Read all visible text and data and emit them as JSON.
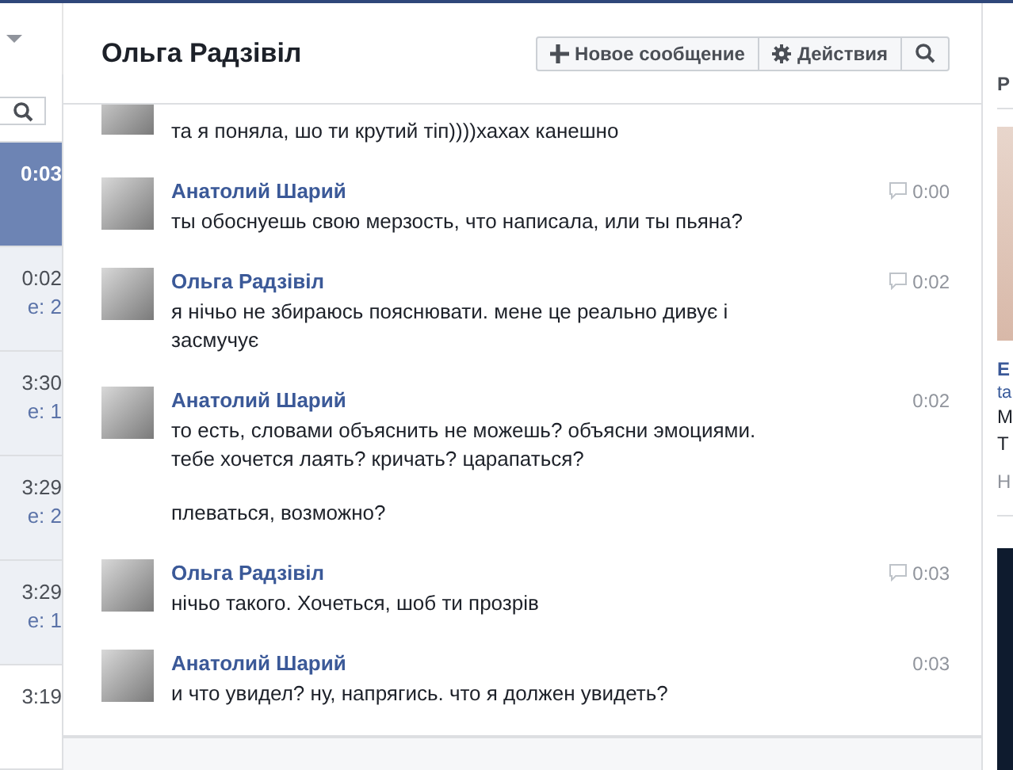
{
  "conversations": {
    "items": [
      {
        "time": "0:03",
        "selected": true,
        "unread": false
      },
      {
        "time": "0:02",
        "snippet": "e: 2",
        "selected": false,
        "unread": true
      },
      {
        "time": "3:30",
        "snippet": "e: 1",
        "selected": false,
        "unread": true
      },
      {
        "time": "3:29",
        "snippet": "e: 2",
        "selected": false,
        "unread": true
      },
      {
        "time": "3:29",
        "snippet": "e: 1",
        "selected": false,
        "unread": true
      },
      {
        "time": "3:19",
        "selected": false,
        "unread": false
      }
    ]
  },
  "thread": {
    "title": "Ольга Радзівіл",
    "buttons": [
      {
        "kind": "plus",
        "label": "Новое сообщение"
      },
      {
        "kind": "gear",
        "label": "Действия"
      },
      {
        "kind": "search"
      }
    ],
    "messages": [
      {
        "paragraphs": [
          "та я поняла, шо ти крутий тіп))))хахах канешно"
        ]
      },
      {
        "author": "Анатолий Шарий",
        "time": "0:00",
        "seen_icon": true,
        "paragraphs": [
          "ты обоснуешь свою мерзость, что написала, или ты пьяна?"
        ]
      },
      {
        "author": "Ольга Радзівіл",
        "time": "0:02",
        "seen_icon": true,
        "paragraphs": [
          "я нічьо не збираюсь пояснювати. мене це реально дивує і засмучує"
        ]
      },
      {
        "author": "Анатолий Шарий",
        "time": "0:02",
        "seen_icon": false,
        "paragraphs": [
          "то есть, словами объяснить не можешь? объясни эмоциями. тебе хочется лаять? кричать? царапаться?",
          "плеваться, возможно?"
        ]
      },
      {
        "author": "Ольга Радзівіл",
        "time": "0:03",
        "seen_icon": true,
        "paragraphs": [
          "нічьо такого. Хочеться, шоб ти прозрів"
        ]
      },
      {
        "author": "Анатолий Шарий",
        "time": "0:03",
        "seen_icon": false,
        "paragraphs": [
          "и что увидел? ну, напрягись. что я должен увидеть?"
        ]
      }
    ]
  },
  "right_panel": {
    "heading": "P",
    "lines": [
      {
        "kind": "title",
        "text": "E"
      },
      {
        "kind": "link",
        "text": "ta"
      },
      {
        "kind": "text",
        "text": "M"
      },
      {
        "kind": "text",
        "text": "T"
      },
      {
        "kind": "meta",
        "text": "H"
      }
    ]
  }
}
